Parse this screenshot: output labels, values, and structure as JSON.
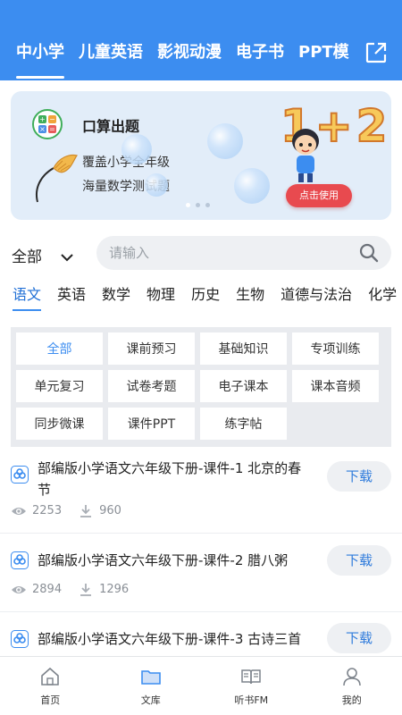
{
  "header": {
    "tabs": [
      {
        "label": "中小学",
        "active": true
      },
      {
        "label": "儿童英语",
        "active": false
      },
      {
        "label": "影视动漫",
        "active": false
      },
      {
        "label": "电子书",
        "active": false
      },
      {
        "label": "PPT模",
        "active": false
      }
    ],
    "share_icon": "share-icon",
    "background": "#3c8df0"
  },
  "banner": {
    "app_icon_label": "口算出题",
    "title": "口算出题",
    "line1": "覆盖小学全年级",
    "line2": "海量数学测试题",
    "graphic_text": "1+2",
    "button_label": "点击使用",
    "button_color": "#e84a4f",
    "active_dot": 1,
    "dot_count": 3
  },
  "search": {
    "scope_label": "全部",
    "placeholder": "请输入",
    "value": ""
  },
  "subjects": [
    {
      "label": "语文",
      "active": true
    },
    {
      "label": "英语",
      "active": false
    },
    {
      "label": "数学",
      "active": false
    },
    {
      "label": "物理",
      "active": false
    },
    {
      "label": "历史",
      "active": false
    },
    {
      "label": "生物",
      "active": false
    },
    {
      "label": "道德与法治",
      "active": false
    },
    {
      "label": "化学",
      "active": false
    }
  ],
  "filters": [
    {
      "label": "全部",
      "active": true
    },
    {
      "label": "课前预习",
      "active": false
    },
    {
      "label": "基础知识",
      "active": false
    },
    {
      "label": "专项训练",
      "active": false
    },
    {
      "label": "单元复习",
      "active": false
    },
    {
      "label": "试卷考题",
      "active": false
    },
    {
      "label": "电子课本",
      "active": false
    },
    {
      "label": "课本音频",
      "active": false
    },
    {
      "label": "同步微课",
      "active": false
    },
    {
      "label": "课件PPT",
      "active": false
    },
    {
      "label": "练字帖",
      "active": false
    }
  ],
  "items": [
    {
      "title": "部编版小学语文六年级下册-课件-1 北京的春节",
      "views": "2253",
      "downloads": "960",
      "button": "下载"
    },
    {
      "title": "部编版小学语文六年级下册-课件-2 腊八粥",
      "views": "2894",
      "downloads": "1296",
      "button": "下载"
    },
    {
      "title": "部编版小学语文六年级下册-课件-3 古诗三首",
      "views": "",
      "downloads": "",
      "button": "下载"
    }
  ],
  "bottom_nav": [
    {
      "label": "首页",
      "icon": "home-icon",
      "active": false
    },
    {
      "label": "文库",
      "icon": "folder-icon",
      "active": true
    },
    {
      "label": "听书FM",
      "icon": "book-icon",
      "active": false
    },
    {
      "label": "我的",
      "icon": "user-icon",
      "active": false
    }
  ]
}
